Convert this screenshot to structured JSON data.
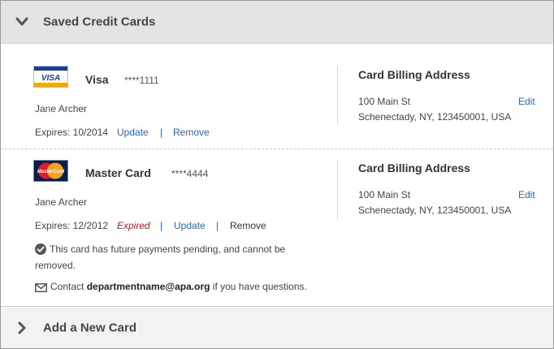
{
  "saved_section": {
    "title": "Saved Credit Cards"
  },
  "cards": [
    {
      "name": "Visa",
      "number": "****1111",
      "logo_text": "VISA",
      "holder": "Jane Archer",
      "expires": "Expires: 10/2014",
      "expired_label": "",
      "update_label": "Update",
      "separator": "|",
      "remove_label": "Remove",
      "billing_title": "Card Billing Address",
      "address_line1": "100 Main St",
      "address_line2": "Schenectady, NY, 123450001, USA",
      "edit_label": "Edit"
    },
    {
      "name": "Master Card",
      "number": "****4444",
      "logo_text": "MasterCard",
      "holder": "Jane Archer",
      "expires": "Expires: 12/2012",
      "expired_label": "Expired",
      "update_label": "Update",
      "separator": "|",
      "remove_label": "Remove",
      "billing_title": "Card Billing Address",
      "address_line1": "100 Main St",
      "address_line2": "Schenectady, NY, 123450001, USA",
      "edit_label": "Edit",
      "pending_notice": "This card has future payments pending, and cannot be removed.",
      "contact_prefix": "Contact",
      "contact_email": "departmentname@apa.org",
      "contact_suffix": "if you have questions."
    }
  ],
  "add_section": {
    "title": "Add a New Card"
  },
  "colors": {
    "link": "#2a64c2",
    "expired": "#d01515",
    "header_bg": "#e4e4e4",
    "visa_blue": "#1a3f8f",
    "visa_gold": "#f2a900"
  }
}
